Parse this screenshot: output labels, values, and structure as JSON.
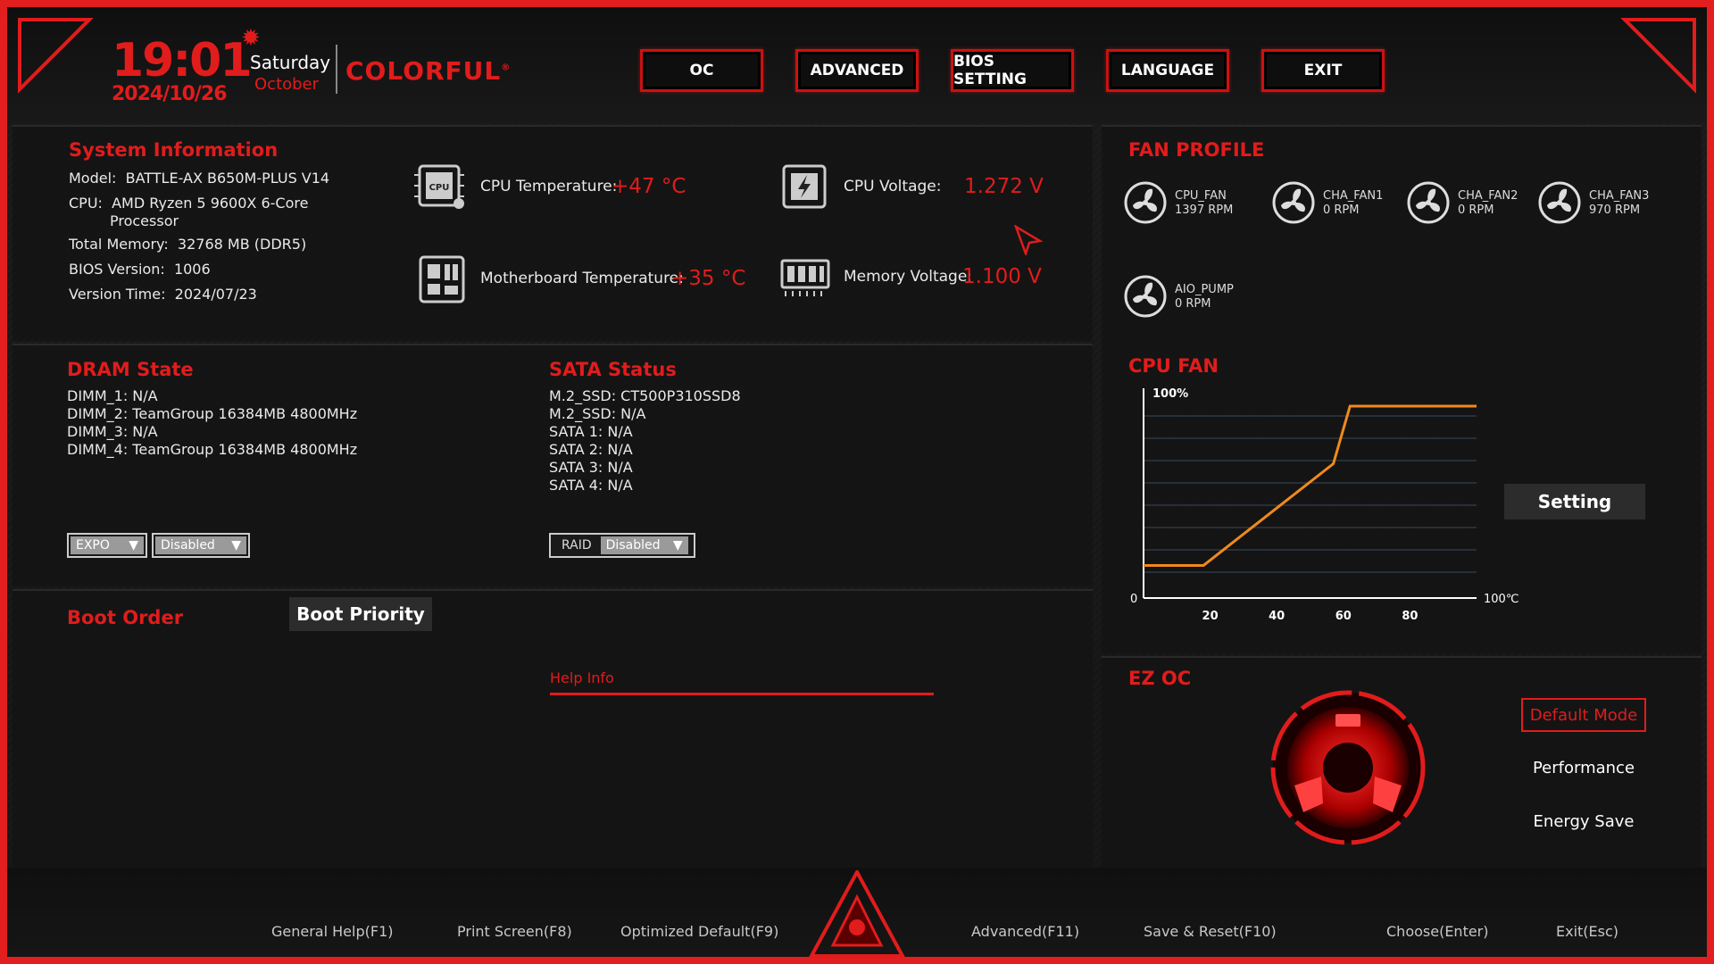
{
  "header": {
    "time": "19:01",
    "date": "2024/10/26",
    "day": "Saturday",
    "month": "October",
    "brand": "COLORFUL",
    "brand_mark": "®",
    "nav": [
      "OC",
      "ADVANCED",
      "BIOS SETTING",
      "LANGUAGE",
      "EXIT"
    ]
  },
  "system_info": {
    "title": "System Information",
    "model_label": "Model:",
    "model": "BATTLE-AX B650M-PLUS V14",
    "cpu_label": "CPU:",
    "cpu_line1": "AMD Ryzen 5 9600X 6-Core",
    "cpu_line2": "Processor",
    "memory_label": "Total Memory:",
    "memory": "32768 MB (DDR5)",
    "bios_label": "BIOS Version:",
    "bios": "1006",
    "version_time_label": "Version Time:",
    "version_time": "2024/07/23"
  },
  "sensors": {
    "cpu_temp_label": "CPU Temperature:",
    "cpu_temp": "+47 °C",
    "cpu_voltage_label": "CPU Voltage:",
    "cpu_voltage": "1.272 V",
    "mb_temp_label": "Motherboard Temperature:",
    "mb_temp": "+35 °C",
    "mem_voltage_label": "Memory Voltage:",
    "mem_voltage": "1.100 V",
    "cpu_icon_text": "CPU"
  },
  "dram": {
    "title": "DRAM State",
    "slots": [
      "DIMM_1: N/A",
      "DIMM_2:  TeamGroup 16384MB 4800MHz",
      "DIMM_3: N/A",
      "DIMM_4:  TeamGroup 16384MB 4800MHz"
    ],
    "expo_value": "EXPO",
    "expo_state": "Disabled"
  },
  "sata": {
    "title": "SATA Status",
    "ports": [
      "M.2_SSD: CT500P310SSD8",
      "M.2_SSD: N/A",
      "SATA 1: N/A",
      "SATA 2: N/A",
      "SATA 3: N/A",
      "SATA 4: N/A"
    ],
    "raid_label": "RAID",
    "raid_state": "Disabled"
  },
  "boot": {
    "title": "Boot Order",
    "priority_button": "Boot Priority",
    "help_info": "Help Info"
  },
  "fan_profile": {
    "title": "FAN PROFILE",
    "fans": [
      {
        "name": "CPU_FAN",
        "rpm": "1397 RPM"
      },
      {
        "name": "CHA_FAN1",
        "rpm": "0 RPM"
      },
      {
        "name": "CHA_FAN2",
        "rpm": "0 RPM"
      },
      {
        "name": "CHA_FAN3",
        "rpm": "970 RPM"
      },
      {
        "name": "AIO_PUMP",
        "rpm": "0 RPM"
      }
    ]
  },
  "cpu_fan": {
    "title": "CPU FAN",
    "setting_button": "Setting"
  },
  "chart_data": {
    "type": "line",
    "title": "CPU FAN",
    "xlabel": "",
    "ylabel": "",
    "x_ticks": [
      "20",
      "40",
      "60",
      "80"
    ],
    "x_end_label": "100℃",
    "y_top_label": "100%",
    "y_zero_label": "0",
    "xlim": [
      0,
      100
    ],
    "ylim": [
      0,
      100
    ],
    "grid": true,
    "series": [
      {
        "color": "#f08a1c",
        "x": [
          0,
          0,
          18,
          57,
          62,
          100
        ],
        "y": [
          17,
          17,
          17,
          70,
          100,
          100
        ]
      }
    ]
  },
  "ez_oc": {
    "title": "EZ OC",
    "options": [
      "Default Mode",
      "Performance",
      "Energy Save"
    ],
    "selected": "Default Mode"
  },
  "footer": [
    "General Help(F1)",
    "Print Screen(F8)",
    "Optimized Default(F9)",
    "Advanced(F11)",
    "Save & Reset(F10)",
    "Choose(Enter)",
    "Exit(Esc)"
  ],
  "colors": {
    "accent": "#e11c1c",
    "curve": "#f08a1c",
    "grid": "#3a4a5a"
  }
}
